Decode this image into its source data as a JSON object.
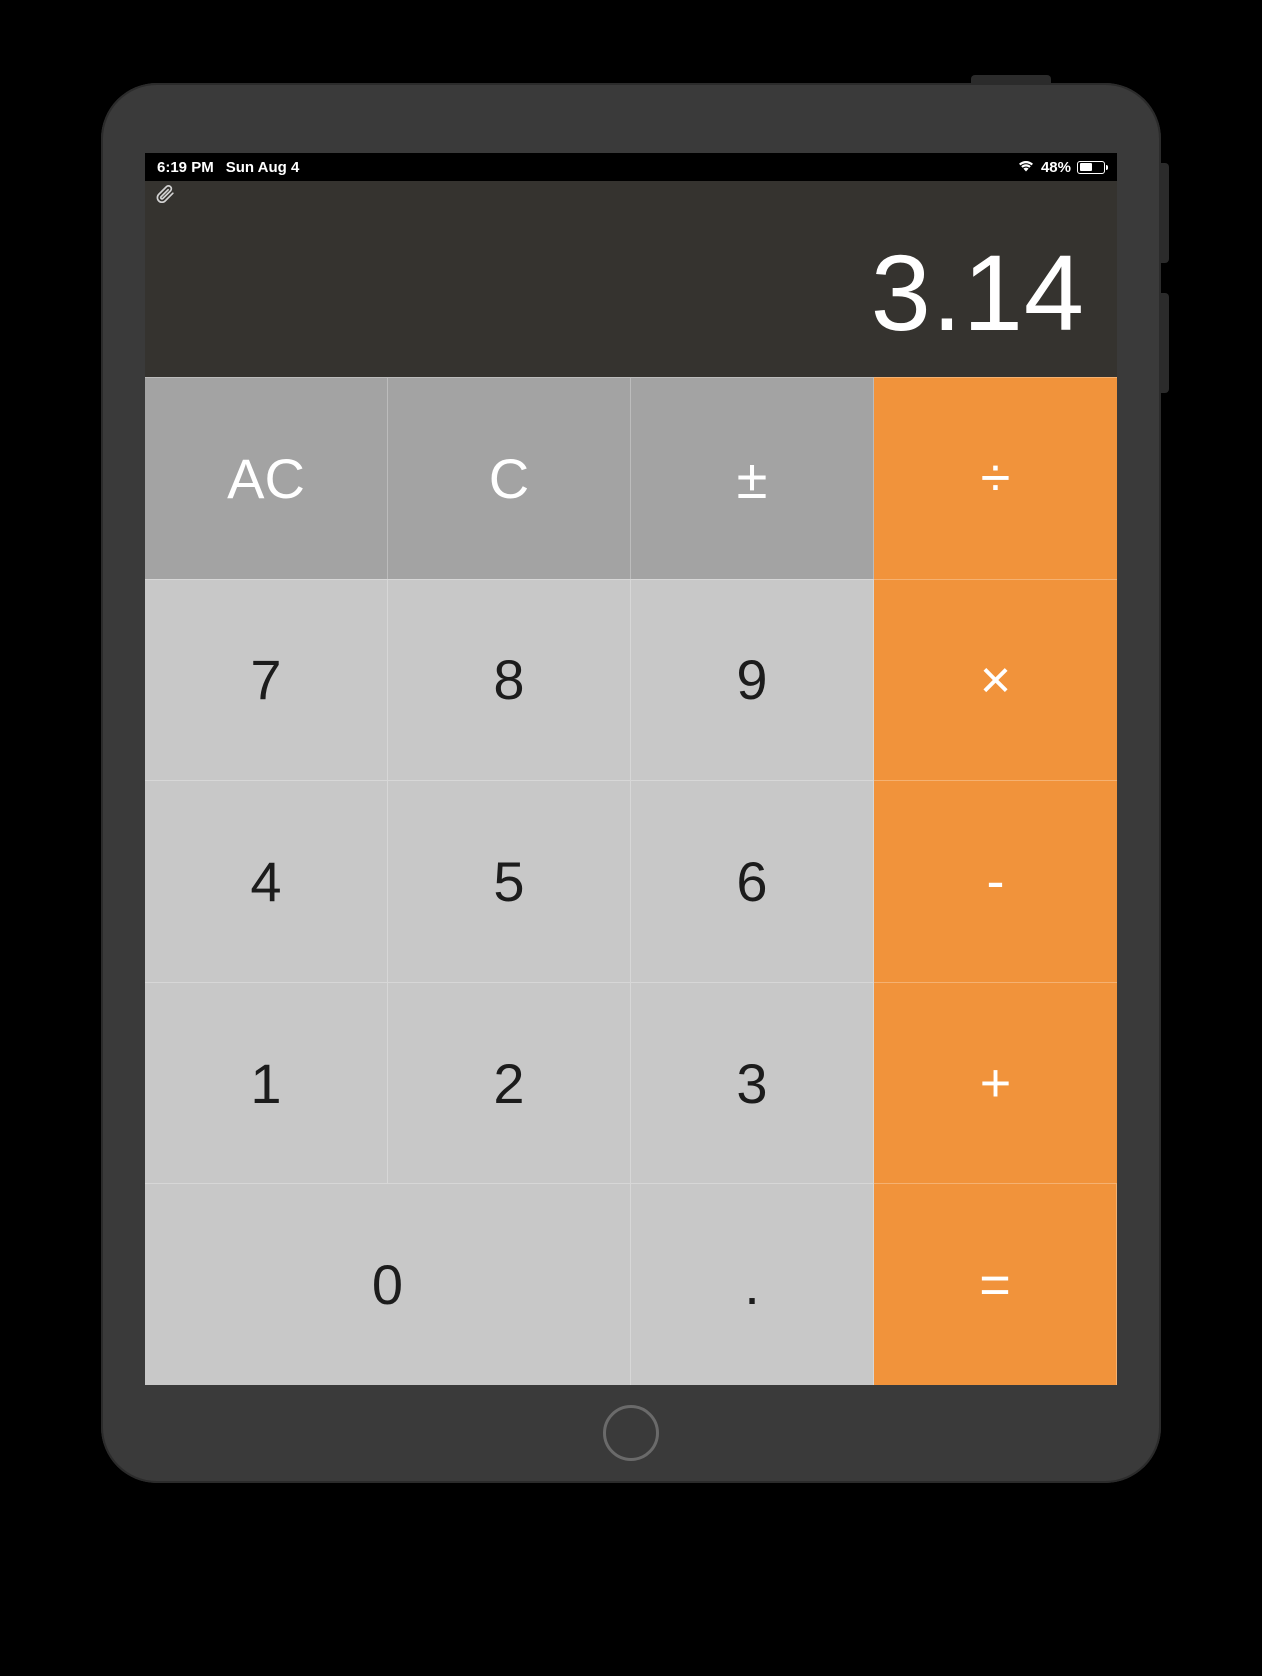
{
  "status": {
    "time": "6:19 PM",
    "date": "Sun Aug 4",
    "battery_pct": "48%"
  },
  "calculator": {
    "display_value": "3.14"
  },
  "keys": {
    "ac": "AC",
    "c": "C",
    "plusminus": "±",
    "divide": "÷",
    "seven": "7",
    "eight": "8",
    "nine": "9",
    "multiply": "×",
    "four": "4",
    "five": "5",
    "six": "6",
    "minus": "-",
    "one": "1",
    "two": "2",
    "three": "3",
    "plus": "+",
    "zero": "0",
    "decimal": ".",
    "equals": "="
  }
}
